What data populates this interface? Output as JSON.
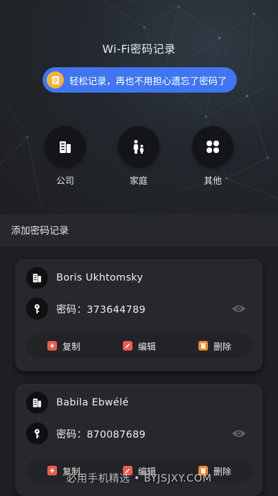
{
  "header": {
    "title": "Wi-Fi密码记录"
  },
  "banner": {
    "text": "轻松记录，再也不用担心遗忘了密码了",
    "icon": "note-icon",
    "color": "#3f76f0"
  },
  "categories": [
    {
      "label": "公司",
      "icon": "building-icon"
    },
    {
      "label": "家庭",
      "icon": "family-icon"
    },
    {
      "label": "其他",
      "icon": "grid-icon"
    }
  ],
  "section": {
    "title": "添加密码记录"
  },
  "records": [
    {
      "name": "Boris Ukhtomsky",
      "password_label": "密码：",
      "password": "373644789"
    },
    {
      "name": "Babila Ebwélé",
      "password_label": "密码：",
      "password": "870087689"
    }
  ],
  "actions": {
    "copy": "复制",
    "edit": "编辑",
    "delete": "删除"
  },
  "watermark": "必用手机精选 • BYJSJXY.COM"
}
